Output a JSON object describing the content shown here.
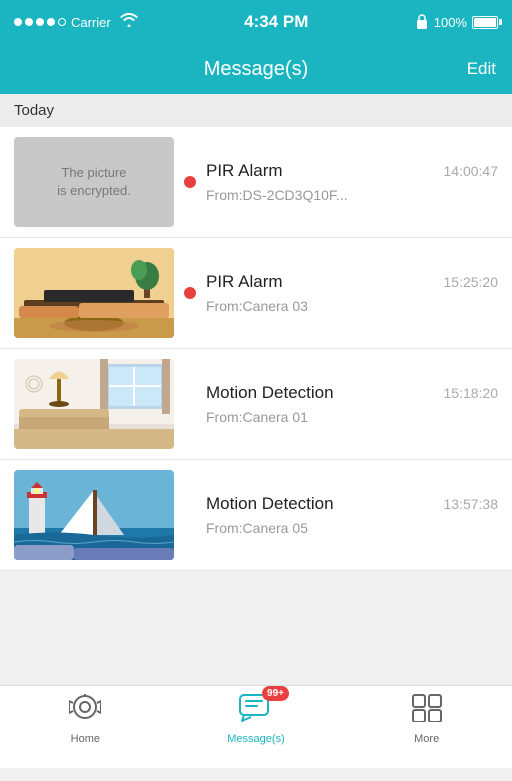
{
  "statusBar": {
    "carrier": "Carrier",
    "time": "4:34 PM",
    "battery": "100%"
  },
  "navBar": {
    "title": "Message(s)",
    "editLabel": "Edit"
  },
  "sectionHeader": {
    "label": "Today"
  },
  "messages": [
    {
      "id": 1,
      "thumbType": "encrypted",
      "thumbText": "The picture\nis encrypted.",
      "type": "PIR Alarm",
      "time": "14:00:47",
      "source": "From:DS-2CD3Q10F...",
      "unread": true
    },
    {
      "id": 2,
      "thumbType": "room1",
      "thumbText": "",
      "type": "PIR Alarm",
      "time": "15:25:20",
      "source": "From:Canera 03",
      "unread": true
    },
    {
      "id": 3,
      "thumbType": "room2",
      "thumbText": "",
      "type": "Motion Detection",
      "time": "15:18:20",
      "source": "From:Canera 01",
      "unread": false
    },
    {
      "id": 4,
      "thumbType": "outdoor",
      "thumbText": "",
      "type": "Motion Detection",
      "time": "13:57:38",
      "source": "From:Canera 05",
      "unread": false
    }
  ],
  "tabs": [
    {
      "id": "home",
      "label": "Home",
      "active": false
    },
    {
      "id": "messages",
      "label": "Message(s)",
      "active": true,
      "badge": "99+"
    },
    {
      "id": "more",
      "label": "More",
      "active": false
    }
  ]
}
